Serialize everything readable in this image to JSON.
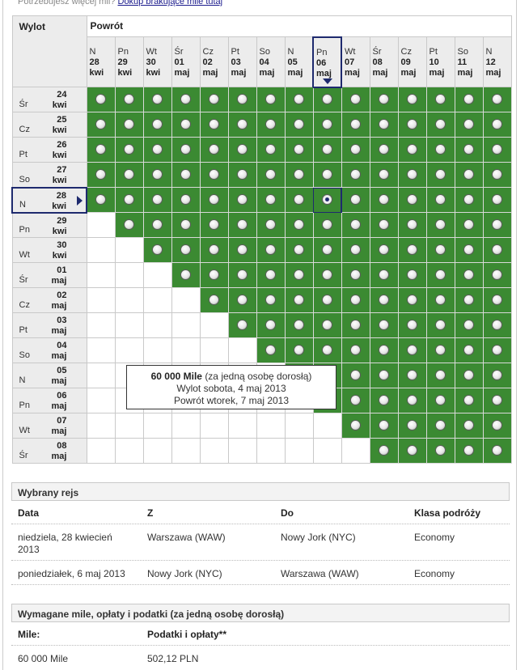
{
  "top_note": {
    "text": "Potrzebujesz więcej mil?",
    "link": "Dokup brakujące mile tutaj"
  },
  "calendar": {
    "return_label": "Powrót",
    "departure_label": "Wylot",
    "return_dates": [
      {
        "wd": "N",
        "d": "28",
        "m": "kwi"
      },
      {
        "wd": "Pn",
        "d": "29",
        "m": "kwi"
      },
      {
        "wd": "Wt",
        "d": "30",
        "m": "kwi"
      },
      {
        "wd": "Śr",
        "d": "01",
        "m": "maj"
      },
      {
        "wd": "Cz",
        "d": "02",
        "m": "maj"
      },
      {
        "wd": "Pt",
        "d": "03",
        "m": "maj"
      },
      {
        "wd": "So",
        "d": "04",
        "m": "maj"
      },
      {
        "wd": "N",
        "d": "05",
        "m": "maj"
      },
      {
        "wd": "Pn",
        "d": "06",
        "m": "maj"
      },
      {
        "wd": "Wt",
        "d": "07",
        "m": "maj"
      },
      {
        "wd": "Śr",
        "d": "08",
        "m": "maj"
      },
      {
        "wd": "Cz",
        "d": "09",
        "m": "maj"
      },
      {
        "wd": "Pt",
        "d": "10",
        "m": "maj"
      },
      {
        "wd": "So",
        "d": "11",
        "m": "maj"
      },
      {
        "wd": "N",
        "d": "12",
        "m": "maj"
      }
    ],
    "departure_dates": [
      {
        "wd": "Śr",
        "d": "24",
        "m": "kwi"
      },
      {
        "wd": "Cz",
        "d": "25",
        "m": "kwi"
      },
      {
        "wd": "Pt",
        "d": "26",
        "m": "kwi"
      },
      {
        "wd": "So",
        "d": "27",
        "m": "kwi"
      },
      {
        "wd": "N",
        "d": "28",
        "m": "kwi"
      },
      {
        "wd": "Pn",
        "d": "29",
        "m": "kwi"
      },
      {
        "wd": "Wt",
        "d": "30",
        "m": "kwi"
      },
      {
        "wd": "Śr",
        "d": "01",
        "m": "maj"
      },
      {
        "wd": "Cz",
        "d": "02",
        "m": "maj"
      },
      {
        "wd": "Pt",
        "d": "03",
        "m": "maj"
      },
      {
        "wd": "So",
        "d": "04",
        "m": "maj"
      },
      {
        "wd": "N",
        "d": "05",
        "m": "maj"
      },
      {
        "wd": "Pn",
        "d": "06",
        "m": "maj"
      },
      {
        "wd": "Wt",
        "d": "07",
        "m": "maj"
      },
      {
        "wd": "Śr",
        "d": "08",
        "m": "maj"
      }
    ],
    "first_available_col": [
      0,
      0,
      0,
      0,
      0,
      1,
      2,
      3,
      4,
      5,
      6,
      7,
      8,
      9,
      10
    ],
    "selected_departure_index": 4,
    "selected_return_index": 8,
    "available_color": "#3b8a32",
    "selection_color": "#1e2a6e"
  },
  "tooltip": {
    "miles": "60 000 Mile",
    "per_person": "(za jedną osobę dorosłą)",
    "departure": "Wylot sobota, 4 maj 2013",
    "return": "Powrót wtorek, 7 maj 2013"
  },
  "selected_flight": {
    "title": "Wybrany rejs",
    "headers": {
      "date": "Data",
      "from": "Z",
      "to": "Do",
      "class": "Klasa podróży"
    },
    "rows": [
      {
        "date_line1": "niedziela, 28 kwiecień",
        "date_line2": "2013",
        "from": "Warszawa (WAW)",
        "to": "Nowy Jork (NYC)",
        "class": "Economy"
      },
      {
        "date_line1": "poniedziałek, 6 maj 2013",
        "date_line2": "",
        "from": "Nowy Jork (NYC)",
        "to": "Warszawa (WAW)",
        "class": "Economy"
      }
    ]
  },
  "required": {
    "title": "Wymagane mile, opłaty i podatki (za jedną osobę dorosłą)",
    "miles_header": "Mile:",
    "taxes_header": "Podatki i opłaty**",
    "miles_value": "60 000 Mile",
    "taxes_value": "502,12 PLN"
  }
}
